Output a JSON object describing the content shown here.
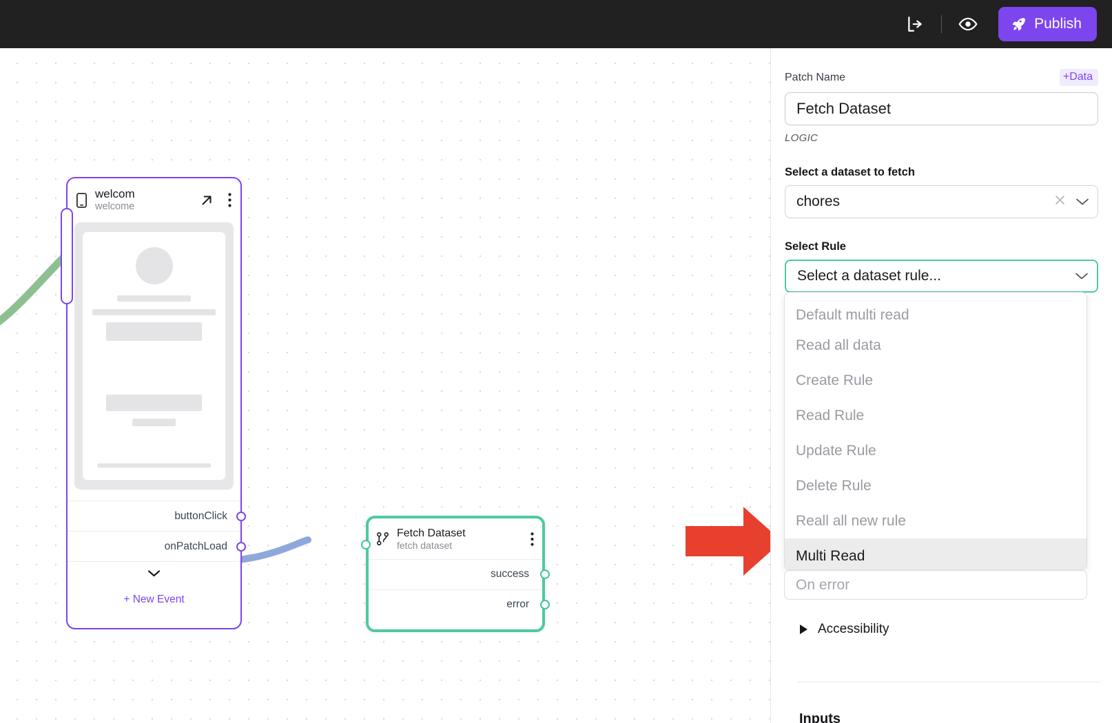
{
  "topbar": {
    "share_icon": "share-icon",
    "preview_icon": "eye-icon",
    "publish_label": "Publish",
    "publish_icon": "rocket-icon",
    "publish_color": "#7C45EE",
    "background": "#212121"
  },
  "canvas": {
    "screen_node": {
      "icon": "phone-icon",
      "title": "welcom",
      "subtitle": "welcome",
      "open_icon": "arrow-up-right-icon",
      "menu_icon": "more-vertical-icon",
      "accent": "#7C45EE",
      "events": [
        {
          "label": "buttonClick"
        },
        {
          "label": "onPatchLoad"
        }
      ],
      "collapse_icon": "chevron-down-icon",
      "new_event_label": "+ New Event"
    },
    "fetch_node": {
      "icon": "branch-icon",
      "title": "Fetch Dataset",
      "subtitle": "fetch dataset",
      "menu_icon": "more-vertical-icon",
      "accent": "#4ECB9C",
      "outputs": [
        {
          "label": "success"
        },
        {
          "label": "error"
        }
      ]
    },
    "annotation": {
      "type": "red-arrow",
      "color": "#E8402F"
    },
    "edge_color": "#8FA8DC",
    "incoming_edge_color": "#8EBF93"
  },
  "panel": {
    "patch_name_label": "Patch Name",
    "data_badge": "+Data",
    "patch_name_value": "Fetch Dataset",
    "logic_label": "LOGIC",
    "dataset_head": "Select a dataset to fetch",
    "dataset_value": "chores",
    "dataset_clear_icon": "close-icon",
    "dataset_chevron_icon": "chevron-down-icon",
    "rule_head": "Select Rule",
    "rule_placeholder": "Select a dataset rule...",
    "rule_chevron_icon": "chevron-down-icon",
    "rule_options": [
      "Default multi read",
      "Read all data",
      "Create Rule",
      "Read Rule",
      "Update Rule",
      "Delete Rule",
      "Reall all new rule",
      "Multi Read"
    ],
    "rule_selected": "Multi Read",
    "on_error_placeholder": "On error",
    "accessibility_label": "Accessibility",
    "accessibility_icon": "triangle-right-icon",
    "inputs_label": "Inputs"
  }
}
